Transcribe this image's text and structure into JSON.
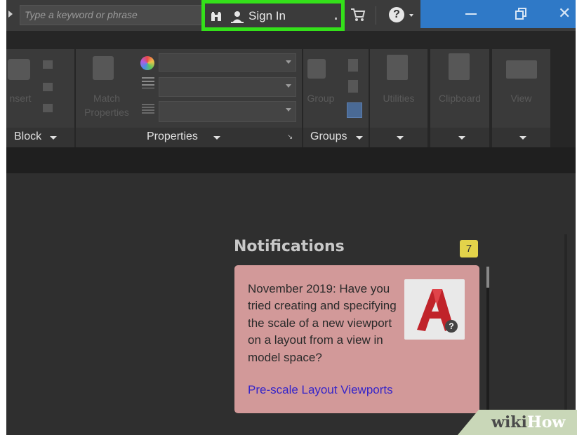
{
  "topbar": {
    "search_placeholder": "Type a keyword or phrase",
    "sign_in_label": "Sign In",
    "help_glyph": "?"
  },
  "ribbon": {
    "block_panel": {
      "insert_label": "nsert",
      "footer": "Block"
    },
    "properties_panel": {
      "match_label_1": "Match",
      "match_label_2": "Properties",
      "footer": "Properties"
    },
    "groups_panel": {
      "group_label": "Group",
      "footer": "Groups"
    },
    "utilities_label": "Utilities",
    "clipboard_label": "Clipboard",
    "view_label": "View"
  },
  "notifications": {
    "title": "Notifications",
    "count": "7",
    "card_text": "November 2019: Have you tried creating and specifying the scale of a new viewport on a layout from a view in model space?",
    "card_link": "Pre-scale Layout Viewports",
    "logo_help_glyph": "?"
  },
  "watermark": {
    "part1": "wiki",
    "part2": "How"
  },
  "colors": {
    "highlight": "#34e01a",
    "window_controls": "#2f79c7",
    "card": "#d29999",
    "link": "#3524c9",
    "badge": "#e3d34a"
  },
  "icons": [
    "expand-arrow-icon",
    "binoculars-icon",
    "user-icon",
    "cart-icon",
    "help-icon",
    "minimize-icon",
    "restore-icon",
    "close-icon",
    "autocad-logo-icon"
  ]
}
